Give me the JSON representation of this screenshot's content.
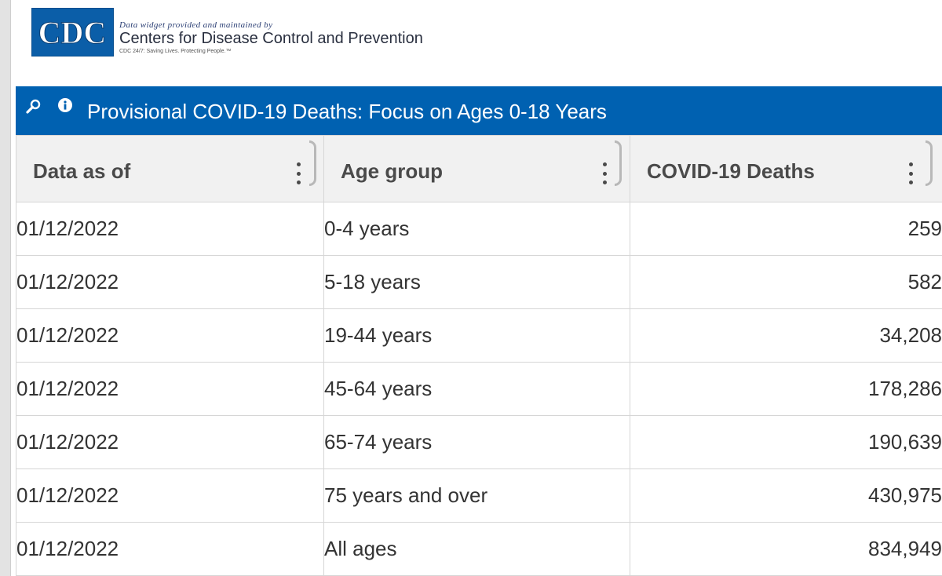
{
  "header": {
    "logo_text": "CDC",
    "tagline": "Data widget provided and maintained by",
    "org_name": "Centers for Disease Control and Prevention",
    "motto": "CDC 24/7: Saving Lives. Protecting People.™"
  },
  "widget": {
    "title": "Provisional COVID-19 Deaths: Focus on Ages 0-18 Years",
    "icons": [
      "search-icon",
      "info-icon"
    ],
    "accent_color": "#0061b1"
  },
  "table": {
    "columns": [
      "Data as of",
      "Age group",
      "COVID-19 Deaths"
    ],
    "rows": [
      [
        "01/12/2022",
        "0-4 years",
        "259"
      ],
      [
        "01/12/2022",
        "5-18 years",
        "582"
      ],
      [
        "01/12/2022",
        "19-44 years",
        "34,208"
      ],
      [
        "01/12/2022",
        "45-64 years",
        "178,286"
      ],
      [
        "01/12/2022",
        "65-74 years",
        "190,639"
      ],
      [
        "01/12/2022",
        "75 years and over",
        "430,975"
      ],
      [
        "01/12/2022",
        "All ages",
        "834,949"
      ]
    ]
  }
}
